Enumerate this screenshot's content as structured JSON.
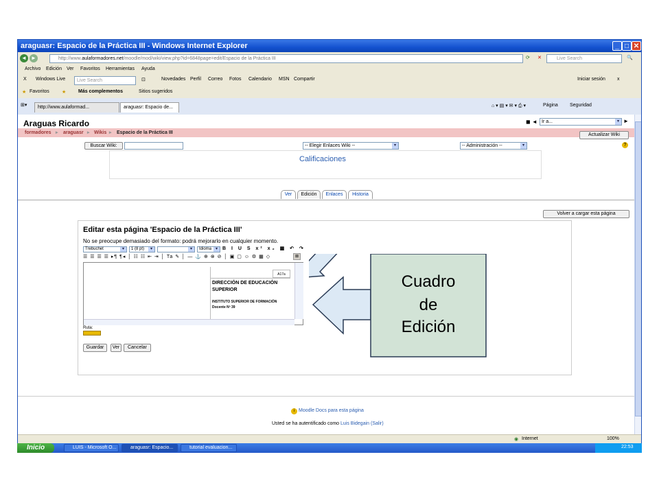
{
  "window": {
    "title": "araguasr: Espacio de la Práctica III - Windows Internet Explorer",
    "address_prefix": "http://www.",
    "address_domain": "aulaformadores.net",
    "address_rest": "/moodle/mod/wiki/view.php?id=6848page=edit/Espacio de la Práctica III",
    "search_placeholder": "Live Search"
  },
  "menubar": [
    "Archivo",
    "Edición",
    "Ver",
    "Favoritos",
    "Herramientas",
    "Ayuda"
  ],
  "live_toolbar": {
    "brand": "Windows Live",
    "search_placeholder": "Live Search",
    "items": [
      "Novedades",
      "Perfil",
      "Correo",
      "Fotos",
      "Calendario",
      "MSN",
      "Compartir"
    ],
    "signin": "Iniciar sesión"
  },
  "favbar": {
    "favorites": "Favoritos",
    "more": "Más complementos",
    "suggested": "Sitios sugeridos"
  },
  "tabs": {
    "tab1": "http://www.aulaformad...",
    "tab2": "araguasr: Espacio de...",
    "page_menu": "Página",
    "security_menu": "Seguridad"
  },
  "moodle": {
    "site_name": "Araguas Ricardo",
    "breadcrumb": [
      "formadores",
      "araguasr",
      "Wikis",
      "Espacio de la Práctica III"
    ],
    "jump_select": "Ir a...",
    "update_wiki": "Actualizar Wiki",
    "search_wiki": "Buscar Wiki:",
    "links_select": "-- Elegir Enlaces Wiki --",
    "admin_select": "-- Administración --",
    "grades_link": "Calificaciones",
    "page_tabs": [
      "Ver",
      "Edición",
      "Enlaces",
      "Historia"
    ],
    "reload_button": "Volver a cargar esta página",
    "edit_heading": "Editar esta página 'Espacio de la Práctica III'",
    "edit_hint": "No se preocupe demasiado del formato: podrá mejorarlo en cualquier momento.",
    "editor": {
      "font_select": "Trebuchet",
      "size_select": "1 (8 pt)",
      "lang_select": "Idioma",
      "doc_label": "A17a",
      "doc_title": "DIRECCIÓN DE EDUCACIÓN SUPERIOR",
      "doc_line1": "INSTITUTO SUPERIOR DE FORMACIÓN",
      "doc_line2": "Docente Nº 39",
      "path_label": "Ruta:"
    },
    "buttons": [
      "Guardar",
      "Ver",
      "Cancelar"
    ],
    "docs_link": "Moodle Docs para esta página",
    "logged_prefix": "Usted se ha autentificado como ",
    "logged_user": "Luis Bidegain",
    "logout": "(Salir)"
  },
  "statusbar": {
    "zone": "Internet",
    "zoom": "100%"
  },
  "taskbar": {
    "start": "Inicio",
    "items": [
      "LUIS - Microsoft O...",
      "araguasr: Espacio...",
      "tutorial evaluacion..."
    ],
    "clock": "22:53"
  },
  "callout": {
    "text_lines": [
      "Cuadro",
      "de",
      "Edición"
    ]
  },
  "colors": {
    "title_blue": "#1452d0",
    "crumb_pink": "#f2c4c4",
    "callout_fill": "#d2e3d6",
    "arrow_fill": "#dce9f5"
  }
}
